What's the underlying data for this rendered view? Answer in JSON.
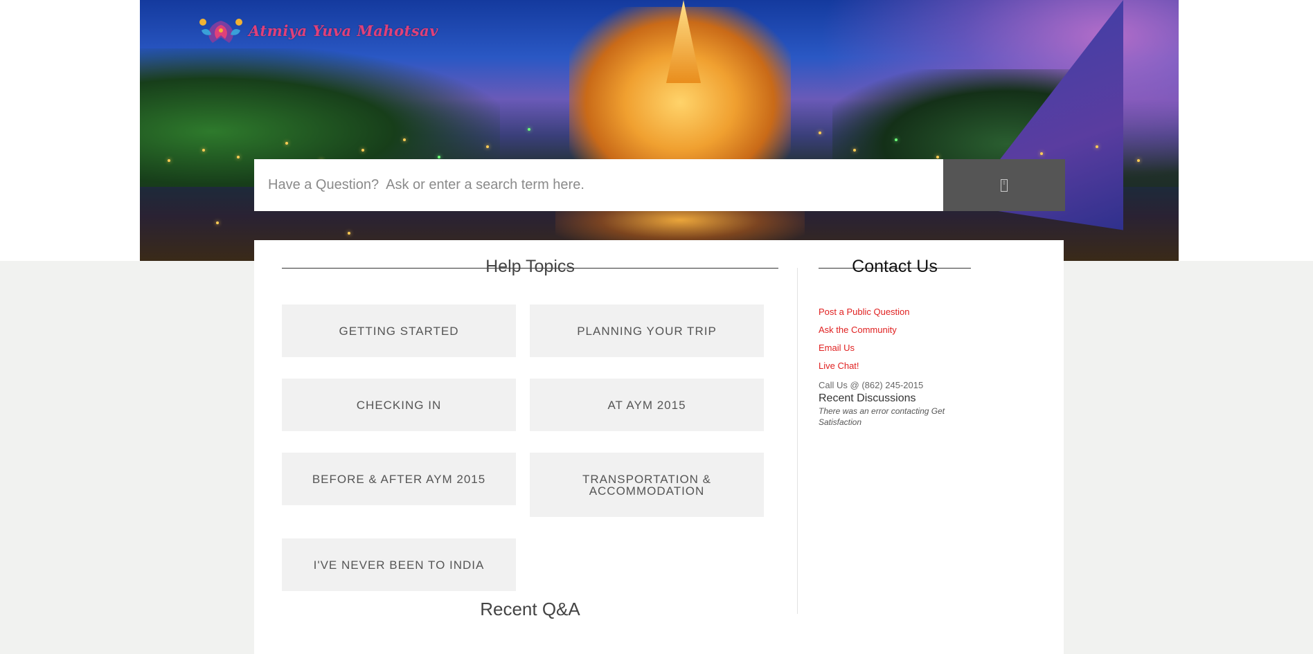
{
  "brand": {
    "name": "Atmiya Yuva Mahotsav"
  },
  "search": {
    "placeholder": "Have a Question?  Ask or enter a search term here.",
    "button_icon": "search-icon"
  },
  "help_topics": {
    "title": "Help Topics",
    "items": [
      "GETTING STARTED",
      "PLANNING YOUR TRIP",
      "CHECKING IN",
      "AT AYM 2015",
      "BEFORE & AFTER AYM 2015",
      "TRANSPORTATION & ACCOMMODATION",
      "I'VE NEVER BEEN TO INDIA"
    ]
  },
  "recent_qa": {
    "title": "Recent Q&A"
  },
  "contact": {
    "title": "Contact Us",
    "links": [
      "Post a Public Question",
      "Ask the Community",
      "Email Us",
      "Live Chat!"
    ],
    "call_us": "Call Us @ (862) 245-2015",
    "recent_discussions_title": "Recent Discussions",
    "recent_discussions_error": "There was an error contacting Get Satisfaction"
  },
  "colors": {
    "link": "#e02020",
    "search_button": "#555555",
    "topic_bg": "#f1f1f1",
    "page_bg": "#f1f2f0"
  }
}
